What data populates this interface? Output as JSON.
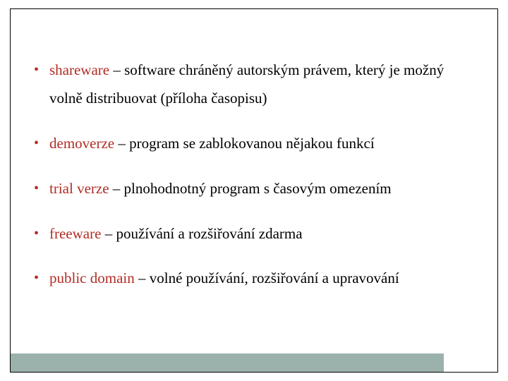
{
  "colors": {
    "accent": "#b32d26",
    "bar": "#9bb2ac",
    "text": "#000000"
  },
  "items": [
    {
      "term": "shareware",
      "desc": "software chráněný autorským právem, který je možný volně distribuovat (příloha časopisu)"
    },
    {
      "term": "demoverze",
      "desc": "program se zablokovanou nějakou funkcí"
    },
    {
      "term": "trial verze",
      "desc": "plnohodnotný program s časovým omezením"
    },
    {
      "term": "freeware",
      "desc": "používání a rozšiřování zdarma"
    },
    {
      "term": "public domain",
      "desc": "volné používání, rozšiřování a upravování"
    }
  ],
  "separator": " – "
}
